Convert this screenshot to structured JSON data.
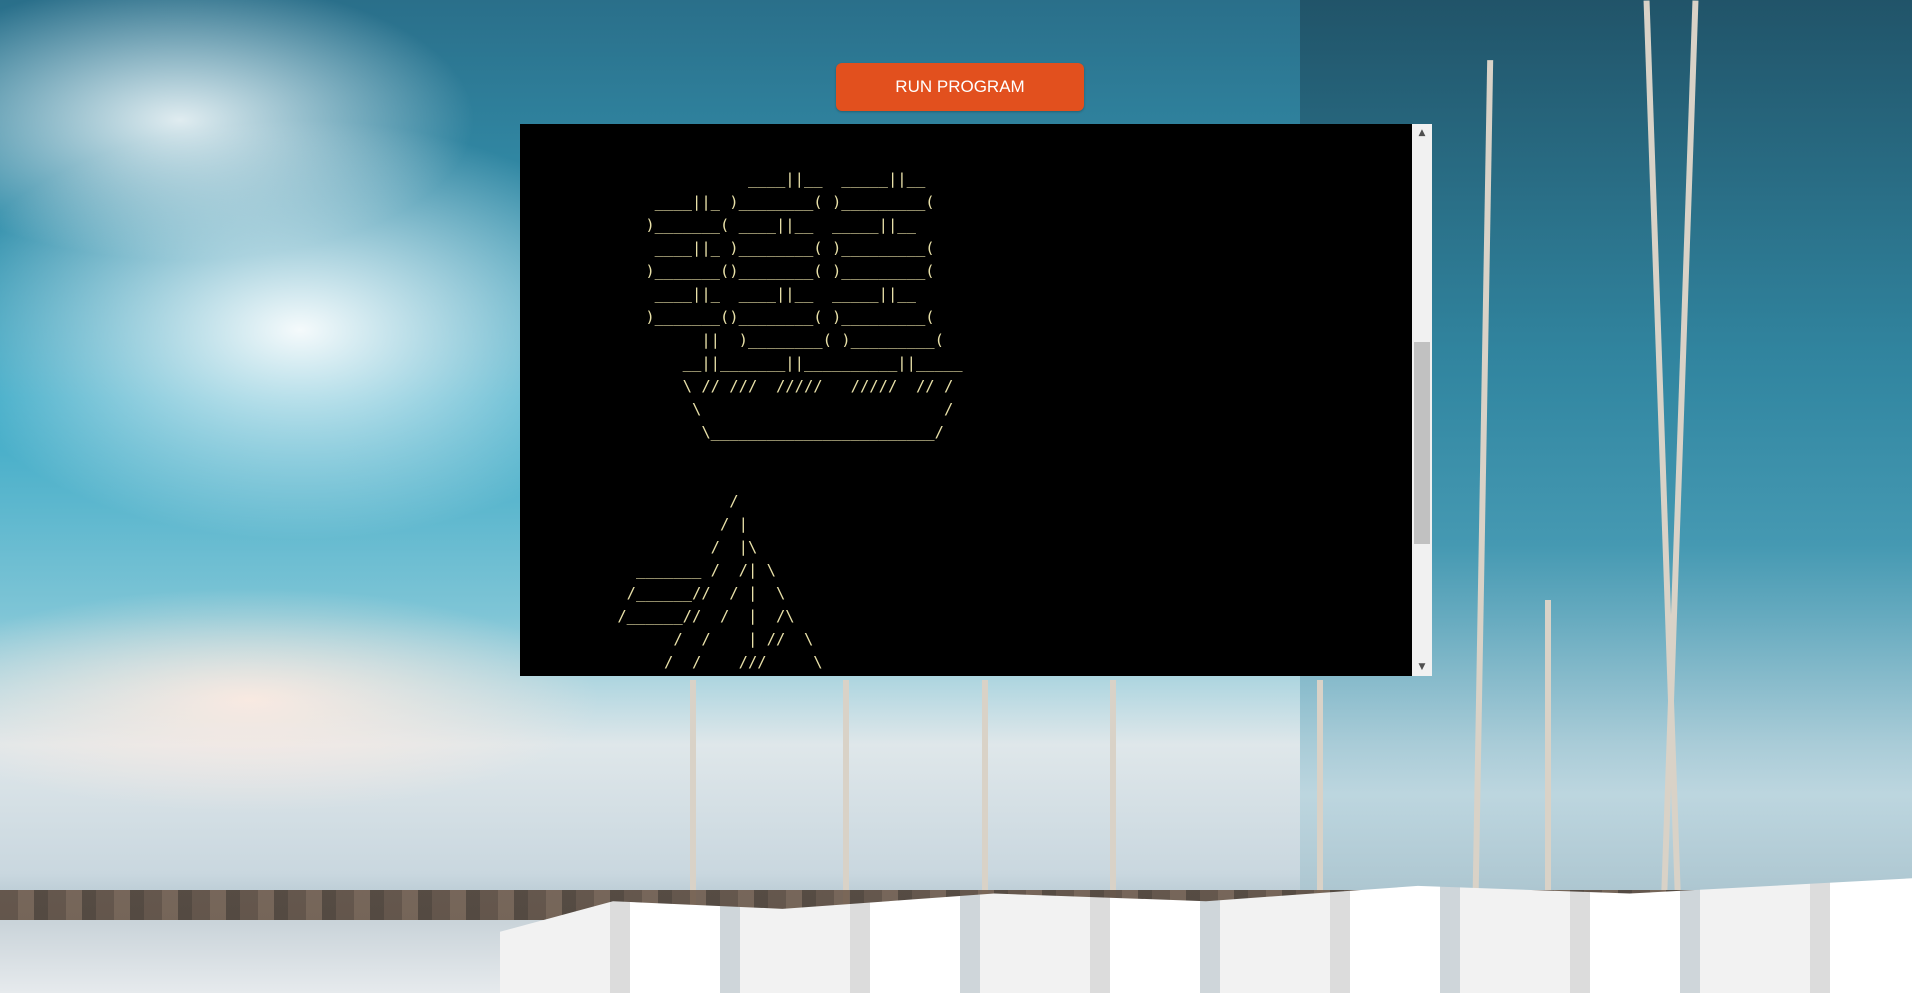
{
  "toolbar": {
    "run_label": "RUN PROGRAM",
    "accent_color": "#e2501e"
  },
  "terminal": {
    "background": "#000000",
    "text_color": "#e8e0a8",
    "output": "                  ____||__  _____||__\n        ____||_ )________( )_________(\n       )_______( ____||__  _____||__\n        ____||_ )________( )_________(\n       )_______()________( )_________(\n        ____||_  ____||__  _____||__\n       )_______()________( )_________(\n             ||  )________( )_________(\n           __||_______||__________||_____\n           \\ // ///  /////   /////  // /\n            \\                          /\n             \\________________________/\n\n\n                /\n               / |\n              /  |\\\n      _______ /  /| \\\n     /______//  / |  \\\n    /______//  /  |  /\\\n          /  /    | //  \\\n         /  /    ///     \\"
  },
  "scrollbar": {
    "up_icon": "▲",
    "down_icon": "▼"
  }
}
